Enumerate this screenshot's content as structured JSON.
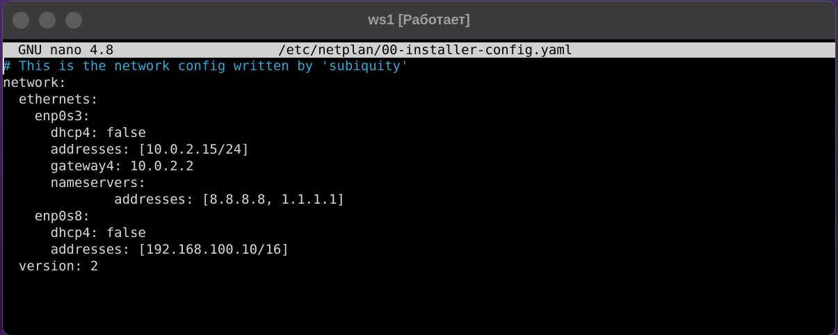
{
  "window": {
    "title": "ws1 [Работает]"
  },
  "nano": {
    "version_label": "GNU nano 4.8",
    "file_path": "/etc/netplan/00-installer-config.yaml",
    "lines": [
      "# This is the network config written by 'subiquity'",
      "network:",
      "  ethernets:",
      "    enp0s3:",
      "      dhcp4: false",
      "      addresses: [10.0.2.15/24]",
      "      gateway4: 10.0.2.2",
      "      nameservers:",
      "              addresses: [8.8.8.8, 1.1.1.1]",
      "    enp0s8:",
      "      dhcp4: false",
      "      addresses: [192.168.100.10/16]",
      "  version: 2"
    ]
  },
  "colors": {
    "comment": "#2fa8d8",
    "text": "#d8d8d8",
    "header_bg": "#d0d0d0",
    "terminal_bg": "#000000"
  }
}
